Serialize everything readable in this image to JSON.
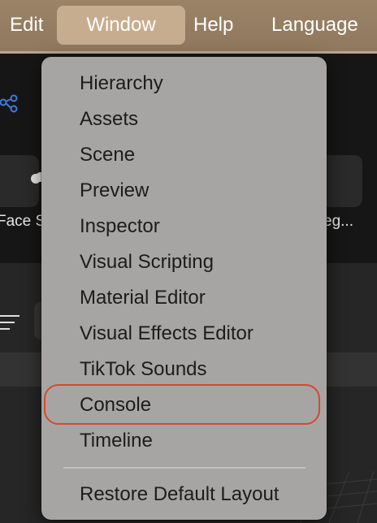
{
  "menubar": {
    "items": [
      "Edit",
      "Window",
      "Help",
      "Language"
    ],
    "active": "Window"
  },
  "background": {
    "tiles": [
      "Face S",
      "eg..."
    ]
  },
  "window_menu": {
    "items": [
      "Hierarchy",
      "Assets",
      "Scene",
      "Preview",
      "Inspector",
      "Visual Scripting",
      "Material Editor",
      "Visual Effects Editor",
      "TikTok Sounds",
      "Console",
      "Timeline"
    ],
    "footer_item": "Restore Default Layout",
    "highlighted": "Console"
  },
  "colors": {
    "menubar": "#9b8367",
    "active_menu": "#c7ad8f",
    "dropdown": "#a7a5a4",
    "highlight_ring": "#d5492e",
    "app_dark": "#161616",
    "icon_blue": "#3e7bd8"
  }
}
